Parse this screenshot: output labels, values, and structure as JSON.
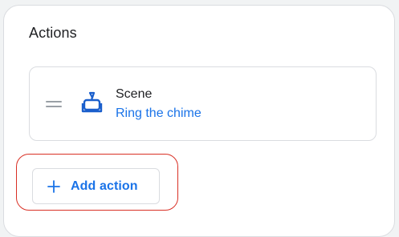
{
  "section": {
    "title": "Actions"
  },
  "action": {
    "type_label": "Scene",
    "value_label": "Ring the chime",
    "icon": "scene-icon"
  },
  "add_button": {
    "label": "Add action",
    "icon": "plus-icon"
  },
  "colors": {
    "accent": "#1a73e8",
    "highlight": "#d93025",
    "border": "#dadce0",
    "text": "#202124"
  }
}
